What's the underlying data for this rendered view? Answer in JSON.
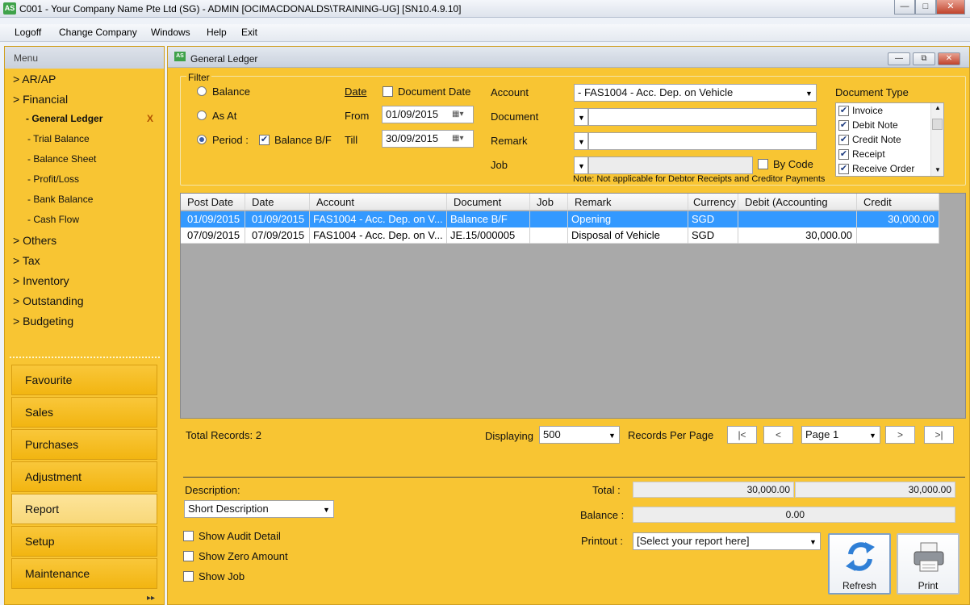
{
  "window": {
    "title": "C001 - Your Company Name Pte Ltd (SG) - ADMIN [OCIMACDONALDS\\TRAINING-UG] [SN10.4.9.10]",
    "icon_text": "AS"
  },
  "menubar": [
    "Logoff",
    "Change Company",
    "Windows",
    "Help",
    "Exit"
  ],
  "sidebar": {
    "header": "Menu",
    "tree": {
      "ar_ap": "> AR/AP",
      "financial": "> Financial",
      "general_ledger": "- General Ledger",
      "gl_close": "X",
      "trial_balance": "- Trial Balance",
      "balance_sheet": "- Balance Sheet",
      "profit_loss": "- Profit/Loss",
      "bank_balance": "- Bank Balance",
      "cash_flow": "- Cash Flow",
      "others": "> Others",
      "tax": "> Tax",
      "inventory": "> Inventory",
      "outstanding": "> Outstanding",
      "budgeting": "> Budgeting"
    },
    "nav": {
      "favourite": "Favourite",
      "sales": "Sales",
      "purchases": "Purchases",
      "adjustment": "Adjustment",
      "report": "Report",
      "setup": "Setup",
      "maintenance": "Maintenance"
    }
  },
  "main": {
    "title": "General Ledger",
    "filter": {
      "legend": "Filter",
      "balance": "Balance",
      "as_at": "As At",
      "period": "Period :",
      "balance_bf": "Balance B/F",
      "date": "Date",
      "document_date": "Document Date",
      "from": "From",
      "from_value": "01/09/2015",
      "till": "Till",
      "till_value": "30/09/2015",
      "account": "Account",
      "account_value": "- FAS1004 - Acc. Dep. on Vehicle",
      "document": "Document",
      "remark": "Remark",
      "job": "Job",
      "by_code": "By Code",
      "note": "Note: Not applicable for Debtor Receipts and Creditor Payments",
      "doc_type_label": "Document Type",
      "doc_types": [
        "Invoice",
        "Debit Note",
        "Credit Note",
        "Receipt",
        "Receive Order"
      ]
    },
    "grid": {
      "columns": [
        "Post Date",
        "Date",
        "Account",
        "Document",
        "Job",
        "Remark",
        "Currency",
        "Debit (Accounting",
        "Credit"
      ],
      "rows": [
        [
          "01/09/2015",
          "01/09/2015",
          "FAS1004 - Acc. Dep. on V...",
          "Balance B/F",
          "",
          "Opening",
          "SGD",
          "",
          "30,000.00"
        ],
        [
          "07/09/2015",
          "07/09/2015",
          "FAS1004 - Acc. Dep. on V...",
          "JE.15/000005",
          "",
          "Disposal of Vehicle",
          "SGD",
          "30,000.00",
          ""
        ]
      ]
    },
    "pager": {
      "total_records": "Total Records: 2",
      "displaying": "Displaying",
      "per_page_value": "500",
      "records_per_page": "Records Per Page",
      "first": "|<",
      "prev": "<",
      "page_value": "Page 1",
      "next": ">",
      "last": ">|"
    },
    "bottom": {
      "description_label": "Description:",
      "description_value": "Short Description",
      "show_audit_detail": "Show Audit Detail",
      "show_zero_amount": "Show Zero Amount",
      "show_job": "Show Job",
      "total_label": "Total :",
      "total_debit": "30,000.00",
      "total_credit": "30,000.00",
      "balance_label": "Balance :",
      "balance_value": "0.00",
      "printout_label": "Printout :",
      "printout_value": "[Select your report here]",
      "refresh": "Refresh",
      "print": "Print"
    }
  },
  "colors": {
    "panel": "#f8c533",
    "selected_row": "#3399ff",
    "accent_border": "#7ea0c8"
  }
}
